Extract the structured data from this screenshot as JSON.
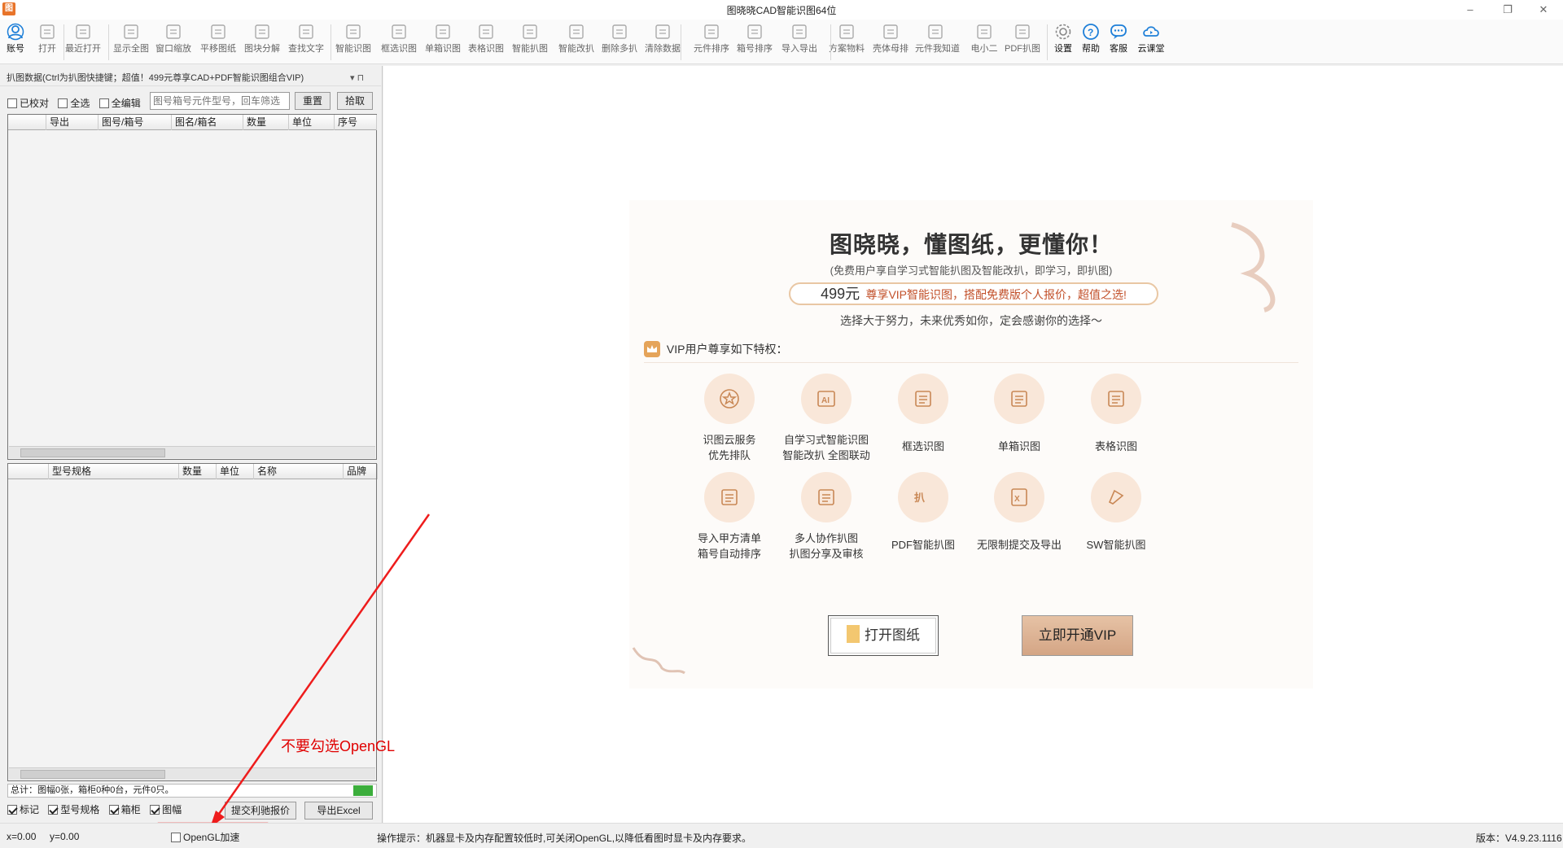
{
  "window": {
    "title": "图晓晓CAD智能识图64位",
    "minimize": "–",
    "maximize": "❐",
    "close": "✕"
  },
  "toolbar": {
    "items": [
      {
        "label": "账号",
        "icon": "account-icon"
      },
      {
        "label": "打开",
        "icon": "open-folder-icon"
      },
      {
        "label": "最近打开",
        "icon": "recent-folder-icon"
      },
      {
        "label": "显示全图",
        "icon": "show-all-icon"
      },
      {
        "label": "窗口缩放",
        "icon": "zoom-window-icon"
      },
      {
        "label": "平移图纸",
        "icon": "pan-icon"
      },
      {
        "label": "图块分解",
        "icon": "explode-block-icon"
      },
      {
        "label": "查找文字",
        "icon": "find-text-icon"
      },
      {
        "label": "智能识图",
        "icon": "ai-recognize-icon"
      },
      {
        "label": "框选识图",
        "icon": "box-select-icon"
      },
      {
        "label": "单箱识图",
        "icon": "single-box-icon"
      },
      {
        "label": "表格识图",
        "icon": "table-recognize-icon"
      },
      {
        "label": "智能扒图",
        "icon": "smart-extract-icon"
      },
      {
        "label": "智能改扒",
        "icon": "smart-modify-icon"
      },
      {
        "label": "删除多扒",
        "icon": "eraser-icon"
      },
      {
        "label": "清除数据",
        "icon": "clear-data-icon"
      },
      {
        "label": "元件排序",
        "icon": "component-sort-icon"
      },
      {
        "label": "箱号排序",
        "icon": "box-sort-icon"
      },
      {
        "label": "导入导出",
        "icon": "import-export-icon"
      },
      {
        "label": "方案物料",
        "icon": "scheme-material-icon"
      },
      {
        "label": "壳体母排",
        "icon": "shell-busbar-icon"
      },
      {
        "label": "元件我知道",
        "icon": "component-know-icon"
      },
      {
        "label": "电小二",
        "icon": "dianxiaoer-icon"
      },
      {
        "label": "PDF扒图",
        "icon": "pdf-extract-icon"
      },
      {
        "label": "设置",
        "icon": "gear-icon"
      },
      {
        "label": "帮助",
        "icon": "help-icon"
      },
      {
        "label": "客服",
        "icon": "chat-icon"
      },
      {
        "label": "云课堂",
        "icon": "cloud-class-icon"
      }
    ]
  },
  "left_panel": {
    "header": "扒图数据(Ctrl为扒图快捷键；超值！499元尊享CAD+PDF智能识图组合VIP)",
    "header_pin": "▾ ⊓",
    "checkboxes": {
      "checked": "已校对",
      "all": "全选",
      "edit_all": "全编辑"
    },
    "search": {
      "placeholder": "图号箱号元件型号，回车筛选"
    },
    "reset_button": "重置",
    "pick_button": "拾取",
    "grid1_columns": [
      "导出",
      "图号/箱号",
      "图名/箱名",
      "数量",
      "单位",
      "序号"
    ],
    "grid2_columns": [
      "型号规格",
      "数量",
      "单位",
      "名称",
      "品牌"
    ],
    "summary": "总计：图幅0张，箱柜0种0台，元件0只。",
    "bottom_checks": [
      "标记",
      "型号规格",
      "箱柜",
      "图幅"
    ],
    "submit_button": "提交利驰报价",
    "export_button": "导出Excel"
  },
  "annotation": {
    "text": "不要勾选OpenGL",
    "color": "#e00000"
  },
  "promo": {
    "headline": "图晓晓，懂图纸，更懂你！",
    "sub1": "(免费用户享自学习式智能扒图及智能改扒，即学习，即扒图)",
    "price": "499元",
    "price_text": "尊享VIP智能识图，搭配免费版个人报价，超值之选!",
    "motto": "选择大于努力，未来优秀如你，定会感谢你的选择～",
    "vip_title": "VIP用户尊享如下特权：",
    "features": [
      {
        "line1": "识图云服务",
        "line2": "优先排队",
        "icon": "star-icon"
      },
      {
        "line1": "自学习式智能识图",
        "line2": "智能改扒 全图联动",
        "icon": "ai-icon"
      },
      {
        "line1": "框选识图",
        "line2": "",
        "icon": "box-select-icon"
      },
      {
        "line1": "单箱识图",
        "line2": "",
        "icon": "single-box-icon"
      },
      {
        "line1": "表格识图",
        "line2": "",
        "icon": "table-icon"
      },
      {
        "line1": "导入甲方清单",
        "line2": "箱号自动排序",
        "icon": "import-list-icon"
      },
      {
        "line1": "多人协作扒图",
        "line2": "扒图分享及审核",
        "icon": "collab-icon"
      },
      {
        "line1": "PDF智能扒图",
        "line2": "",
        "icon": "pdf-ocr-icon"
      },
      {
        "line1": "无限制提交及导出",
        "line2": "",
        "icon": "excel-icon"
      },
      {
        "line1": "SW智能扒图",
        "line2": "",
        "icon": "sw-icon"
      }
    ],
    "open_drawing_button": "打开图纸",
    "open_vip_button": "立即开通VIP",
    "accent": "#b5672c"
  },
  "statusbar": {
    "x": "x=0.00",
    "y": "y=0.00",
    "opengl": "OpenGL加速",
    "tip": "操作提示：机器显卡及内存配置较低时,可关闭OpenGL,以降低看图时显卡及内存要求。",
    "version": "版本：V4.9.23.1116"
  }
}
